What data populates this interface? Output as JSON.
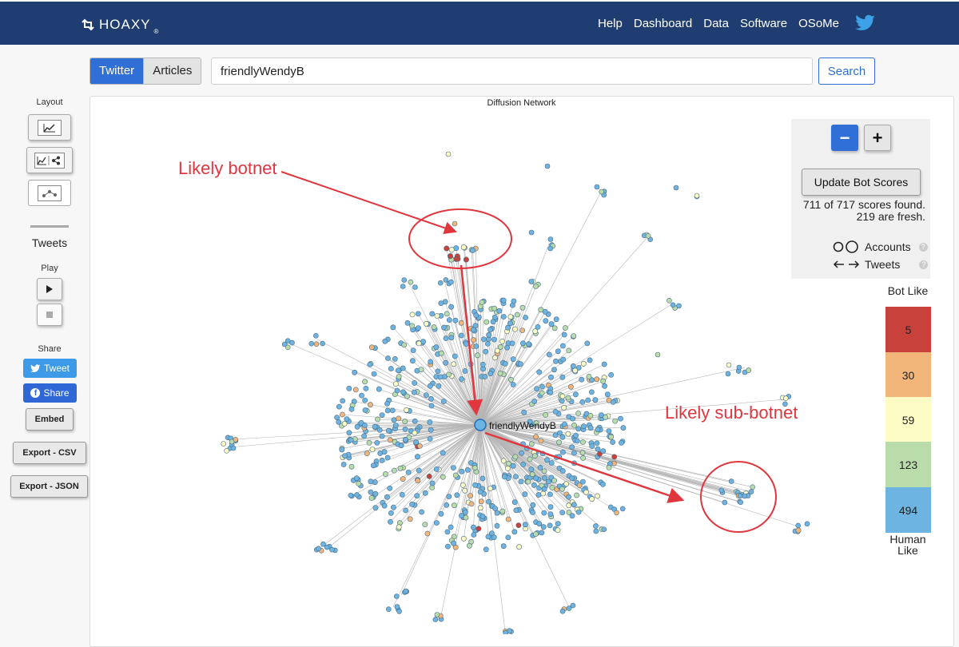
{
  "header": {
    "brand": "HOAXY",
    "brand_mark": "®",
    "nav": [
      "Help",
      "Dashboard",
      "Data",
      "Software",
      "OSoMe"
    ],
    "twitter_icon": "twitter-bird-icon"
  },
  "search": {
    "tabs": [
      {
        "label": "Twitter",
        "active": true
      },
      {
        "label": "Articles",
        "active": false
      }
    ],
    "query": "friendlyWendyB",
    "button": "Search"
  },
  "sidebar": {
    "layout_label": "Layout",
    "tweets_label": "Tweets",
    "play_label": "Play",
    "share_label": "Share",
    "tweet_button": "Tweet",
    "share_button": "Share",
    "embed_button": "Embed",
    "export_csv": "Export - CSV",
    "export_json": "Export - JSON"
  },
  "panel": {
    "title": "Diffusion Network",
    "center_node_label": "friendlyWendyB"
  },
  "annotations": {
    "botnet": "Likely botnet",
    "sub_botnet": "Likely sub-botnet"
  },
  "controls": {
    "zoom_out": "−",
    "zoom_in": "+",
    "update_button": "Update Bot Scores",
    "scores_found": "711 of 717 scores found.",
    "scores_fresh": "219 are fresh.",
    "legend_accounts": "Accounts",
    "legend_tweets": "Tweets"
  },
  "bot_scale": {
    "top_label": "Bot Like",
    "bottom_label": "Human Like",
    "levels": [
      {
        "count": "5",
        "color": "#c8413a"
      },
      {
        "count": "30",
        "color": "#f2b67a"
      },
      {
        "count": "59",
        "color": "#fcfcc4"
      },
      {
        "count": "123",
        "color": "#b9dcaa"
      },
      {
        "count": "494",
        "color": "#6db4e2"
      }
    ]
  },
  "colors": {
    "navbar": "#1f3d70",
    "accent": "#2f6fd6",
    "annotation": "#e0373f"
  }
}
